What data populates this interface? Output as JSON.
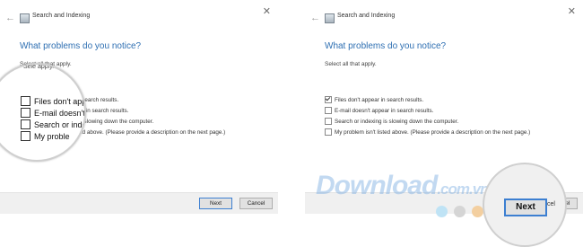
{
  "window": {
    "title": "Search and Indexing",
    "back_glyph": "←",
    "close_glyph": "✕"
  },
  "content": {
    "heading": "What problems do you notice?",
    "subheading": "Select all that apply."
  },
  "left_panel": {
    "options": [
      {
        "label": "Files don't appear in search results.",
        "checked": false
      },
      {
        "label": "E-mail doesn't appear in search results.",
        "checked": false
      },
      {
        "label": "Search or indexing is slowing down the computer.",
        "checked": false
      },
      {
        "label": "My problem isn't listed above. (Please provide a description on the next page.)",
        "checked": false
      }
    ]
  },
  "right_panel": {
    "options": [
      {
        "label": "Files don't appear in search results.",
        "checked": true
      },
      {
        "label": "E-mail doesn't appear in search results.",
        "checked": false
      },
      {
        "label": "Search or indexing is slowing down the computer.",
        "checked": false
      },
      {
        "label": "My problem isn't listed above. (Please provide a description on the next page.)",
        "checked": false
      }
    ]
  },
  "footer": {
    "next_label": "Next",
    "cancel_label": "Cancel"
  },
  "magnifier_left": {
    "subheading_partial": "Sele          apply.",
    "options": [
      {
        "label": "Files don't appear"
      },
      {
        "label": "E-mail doesn't ap"
      },
      {
        "label": "Search or index"
      },
      {
        "label": "My proble"
      }
    ]
  },
  "magnifier_right": {
    "next_label": "Next",
    "cancel_partial": "cel"
  },
  "watermark": {
    "text": "Download",
    "domain": ".com.vn",
    "dot_colors": [
      "#bfe3f5",
      "#d5d5d5",
      "#f3cfa0",
      "#bfe5b6",
      "#a6d3f5",
      "#f3b3c3"
    ]
  }
}
